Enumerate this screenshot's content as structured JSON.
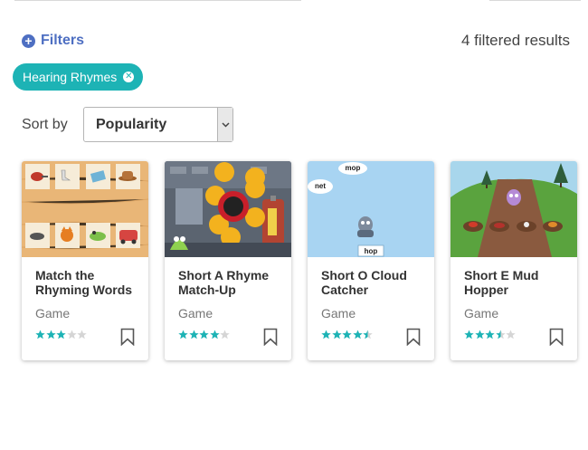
{
  "filters": {
    "label": "Filters",
    "results_text": "4 filtered results"
  },
  "active_filter": {
    "label": "Hearing Rhymes",
    "remove_icon": "close-circle-icon"
  },
  "sort": {
    "label": "Sort by",
    "selected": "Popularity"
  },
  "colors": {
    "accent_blue": "#4e6fc2",
    "teal": "#1db3b5",
    "star_filled": "#1db3b5",
    "star_empty": "#d5d5d5"
  },
  "cards": [
    {
      "title": "Match the Rhyming Words",
      "type": "Game",
      "rating": 3,
      "thumbnail": "wooden-board-rhyme-tiles",
      "thumb_labels": []
    },
    {
      "title": "Short A Rhyme Match-Up",
      "type": "Game",
      "rating": 4,
      "thumbnail": "robot-machine-rhymes",
      "thumb_labels": []
    },
    {
      "title": "Short O Cloud Catcher",
      "type": "Game",
      "rating": 4.5,
      "thumbnail": "sky-clouds-robot",
      "thumb_labels": [
        "mop",
        "net",
        "hop"
      ]
    },
    {
      "title": "Short E Mud Hopper",
      "type": "Game",
      "rating": 3.5,
      "thumbnail": "mud-path-monster",
      "thumb_labels": []
    }
  ]
}
